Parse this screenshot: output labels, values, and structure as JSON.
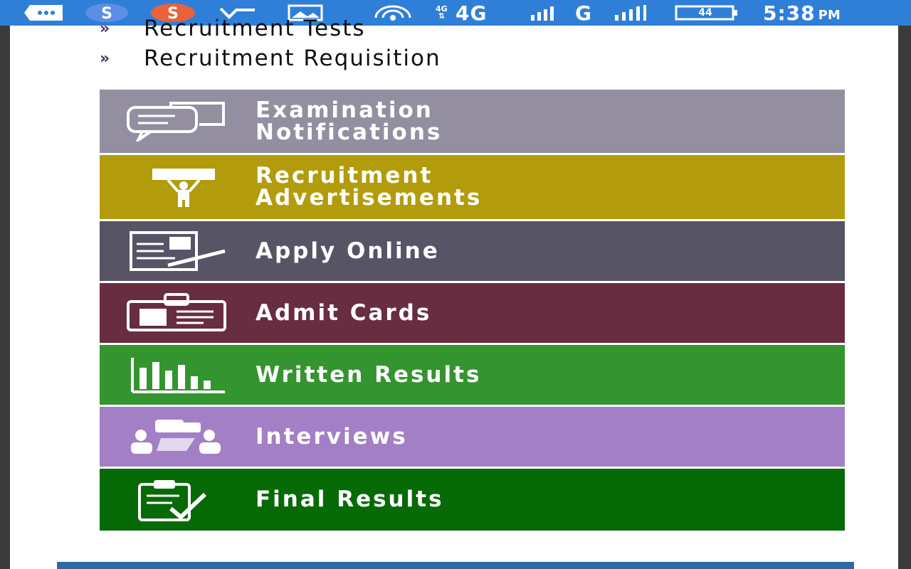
{
  "status_bar": {
    "time": "5:38",
    "ampm": "PM",
    "network_4g_small": "4G",
    "network_4g": "4G",
    "network_g": "G",
    "battery": "44"
  },
  "links": [
    {
      "label": "Recruitment Tests"
    },
    {
      "label": "Recruitment Requisition"
    }
  ],
  "menu": [
    {
      "label": "Examination\nNotifications",
      "color": "#938fa0",
      "icon": "chat-bubbles-icon"
    },
    {
      "label": "Recruitment\nAdvertisements",
      "color": "#b39c0c",
      "icon": "person-with-banner-icon"
    },
    {
      "label": "Apply Online",
      "color": "#575466",
      "icon": "form-with-pen-icon"
    },
    {
      "label": "Admit Cards",
      "color": "#682d40",
      "icon": "id-card-icon"
    },
    {
      "label": "Written Results",
      "color": "#34942f",
      "icon": "bar-chart-icon"
    },
    {
      "label": "Interviews",
      "color": "#a37fc6",
      "icon": "people-talking-icon"
    },
    {
      "label": "Final Results",
      "color": "#066a06",
      "icon": "clipboard-check-icon"
    }
  ]
}
